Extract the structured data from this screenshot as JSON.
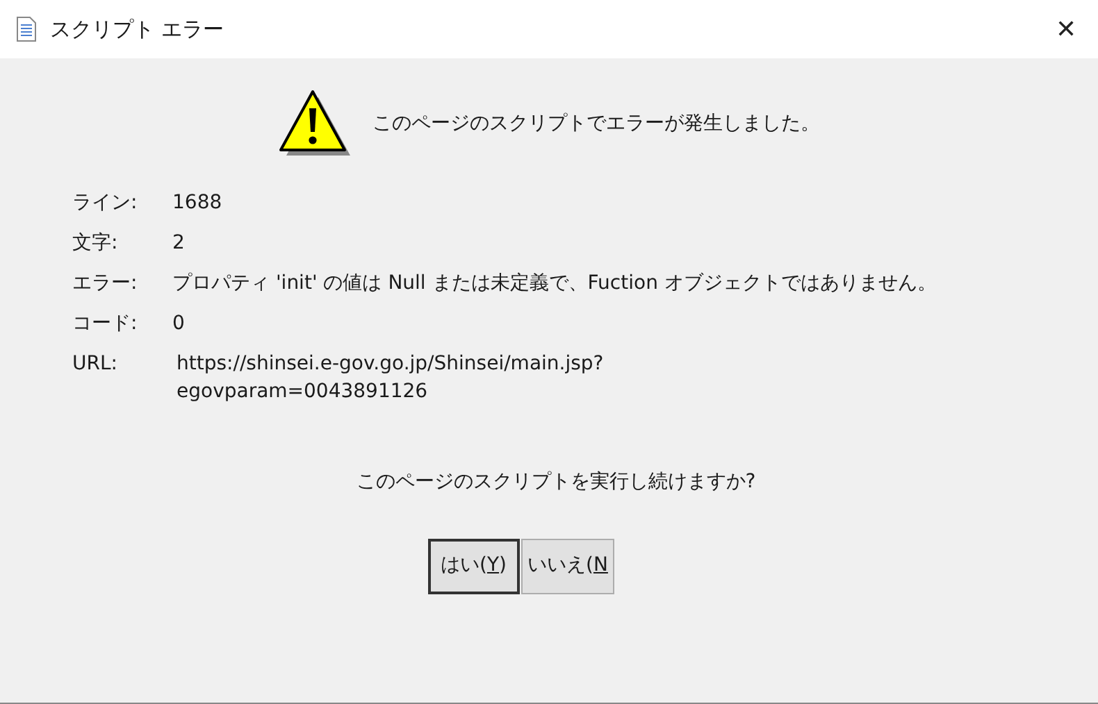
{
  "window": {
    "title": "スクリプト エラー",
    "close": "✕"
  },
  "message": "このページのスクリプトでエラーが発生しました。",
  "details": [
    {
      "label": "ライン:",
      "value": "1688"
    },
    {
      "label": "文字:",
      "value": "2"
    },
    {
      "label": "エラー:",
      "value": "プロパティ 'init' の値は Null または未定義で、Fuction オブジェクトではありません。"
    },
    {
      "label": "コード:",
      "value": "0"
    },
    {
      "label": "URL:",
      "value": "https://shinsei.e-gov.go.jp/Shinsei/main.jsp?\negovparam=0043891126"
    }
  ],
  "question": "このページのスクリプトを実行し続けますか?",
  "buttons": [
    {
      "label_before": "はい(",
      "access_key": "Y",
      "label_after": ")",
      "default": true
    },
    {
      "label_before": "いいえ(",
      "access_key": "N",
      "default": false
    }
  ]
}
